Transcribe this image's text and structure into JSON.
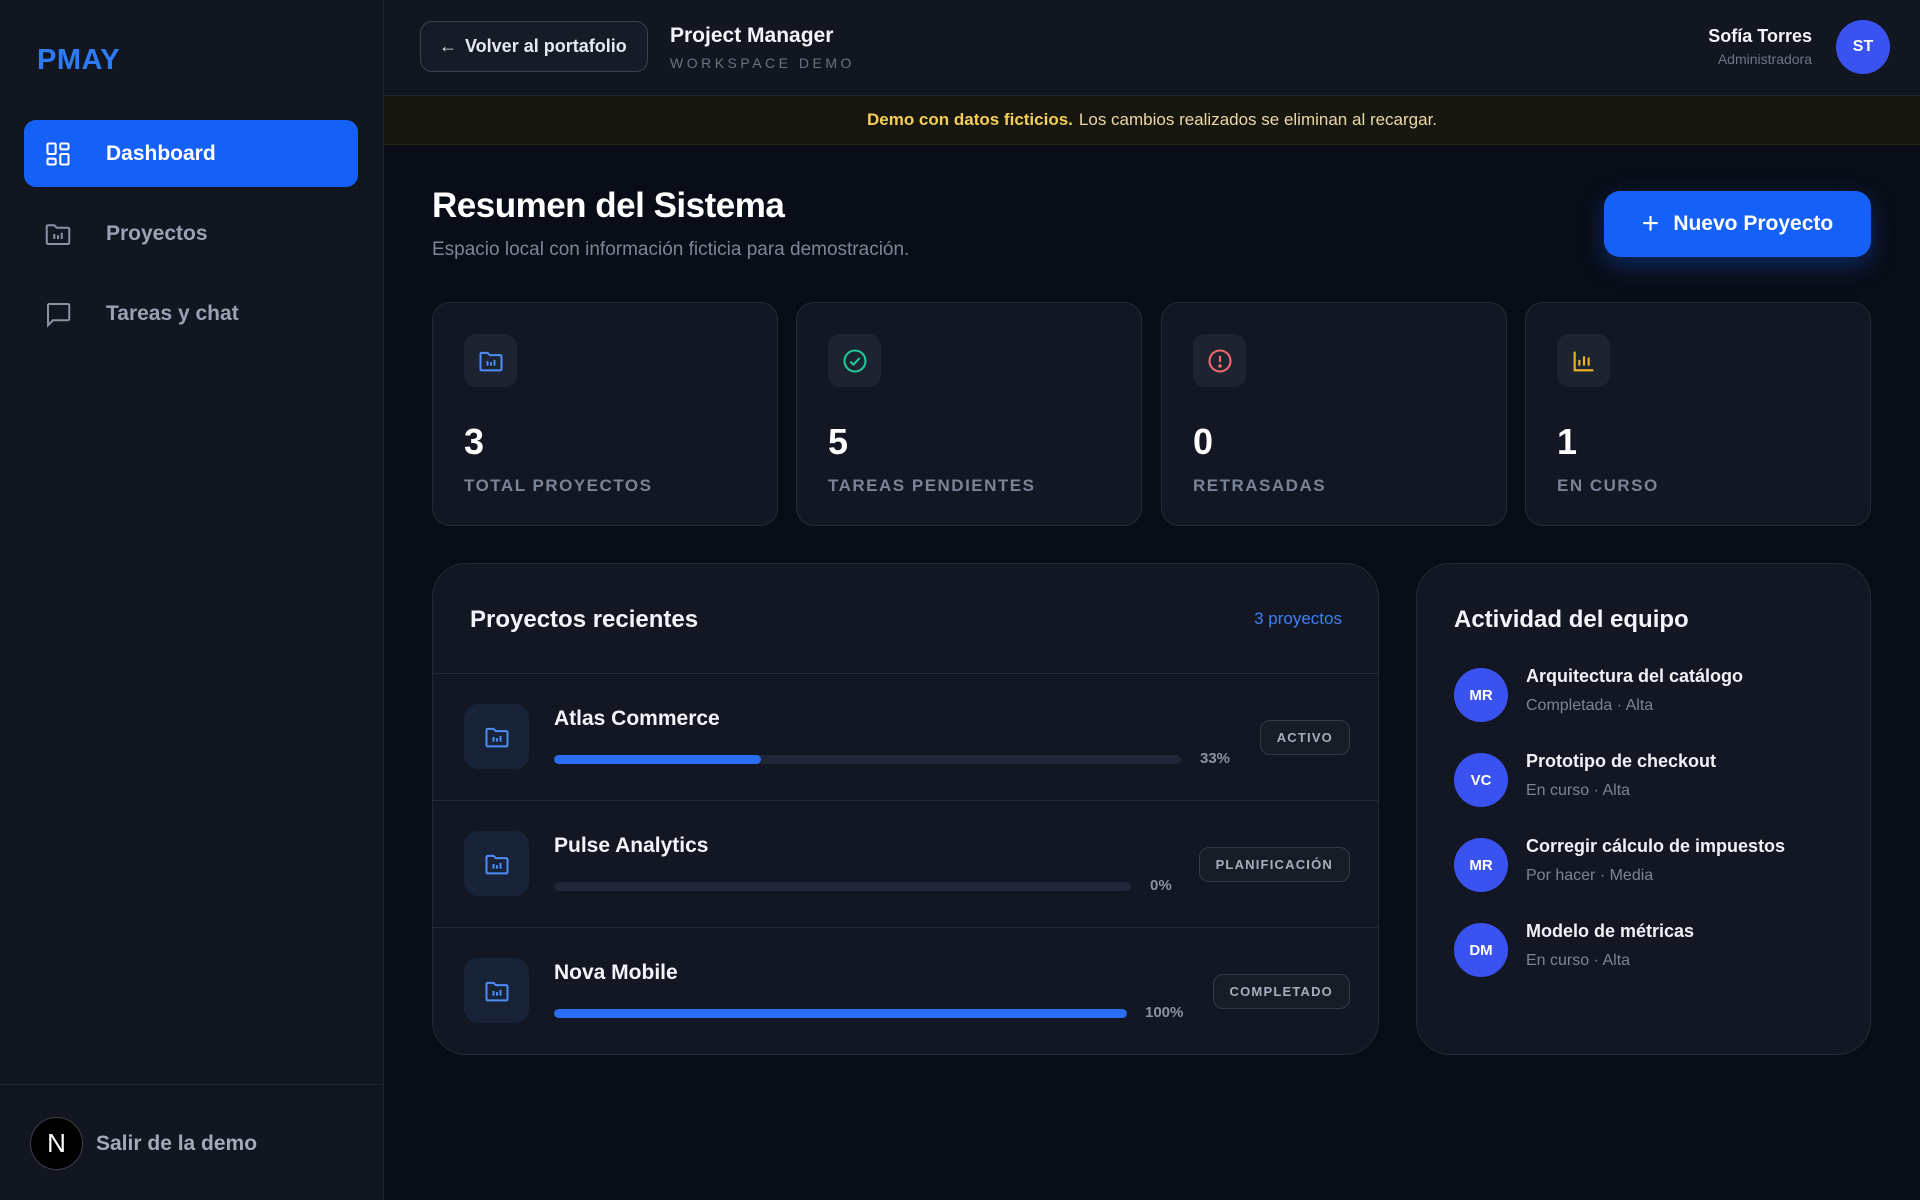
{
  "sidebar": {
    "brand": "PMAY",
    "items": [
      {
        "label": "Dashboard",
        "icon": "dashboard-icon",
        "active": true
      },
      {
        "label": "Proyectos",
        "icon": "folder-icon",
        "active": false
      },
      {
        "label": "Tareas y chat",
        "icon": "chat-icon",
        "active": false
      }
    ],
    "footer": {
      "avatar_letter": "N",
      "label": "Salir de la demo"
    }
  },
  "header": {
    "back_label": "Volver al portafolio",
    "title": "Project Manager",
    "subtitle": "WORKSPACE DEMO",
    "user": {
      "name": "Sofía Torres",
      "role": "Administradora",
      "initials": "ST"
    }
  },
  "banner": {
    "bold": "Demo con datos ficticios.",
    "text": "Los cambios realizados se eliminan al recargar."
  },
  "main": {
    "title": "Resumen del Sistema",
    "subtitle": "Espacio local con información ficticia para demostración.",
    "new_button": "Nuevo Proyecto",
    "stats": [
      {
        "value": "3",
        "label": "TOTAL PROYECTOS",
        "icon": "folder-chart-icon",
        "color": "#4d8ef7"
      },
      {
        "value": "5",
        "label": "TAREAS PENDIENTES",
        "icon": "check-circle-icon",
        "color": "#20c997"
      },
      {
        "value": "0",
        "label": "RETRASADAS",
        "icon": "alert-circle-icon",
        "color": "#f06a6a"
      },
      {
        "value": "1",
        "label": "EN CURSO",
        "icon": "bar-chart-icon",
        "color": "#f0b429"
      }
    ],
    "recent": {
      "title": "Proyectos recientes",
      "count_link": "3 proyectos",
      "projects": [
        {
          "name": "Atlas Commerce",
          "progress": 33,
          "progress_label": "33%",
          "status": "ACTIVO"
        },
        {
          "name": "Pulse Analytics",
          "progress": 0,
          "progress_label": "0%",
          "status": "PLANIFICACIÓN"
        },
        {
          "name": "Nova Mobile",
          "progress": 100,
          "progress_label": "100%",
          "status": "COMPLETADO"
        }
      ]
    },
    "activity": {
      "title": "Actividad del equipo",
      "items": [
        {
          "initials": "MR",
          "title": "Arquitectura del catálogo",
          "meta": "Completada · Alta"
        },
        {
          "initials": "VC",
          "title": "Prototipo de checkout",
          "meta": "En curso · Alta"
        },
        {
          "initials": "MR",
          "title": "Corregir cálculo de impuestos",
          "meta": "Por hacer · Media"
        },
        {
          "initials": "DM",
          "title": "Modelo de métricas",
          "meta": "En curso · Alta"
        }
      ]
    }
  },
  "colors": {
    "accent": "#1561f7",
    "avatar": "#3a52f0",
    "banner_bold": "#f4cf58"
  }
}
